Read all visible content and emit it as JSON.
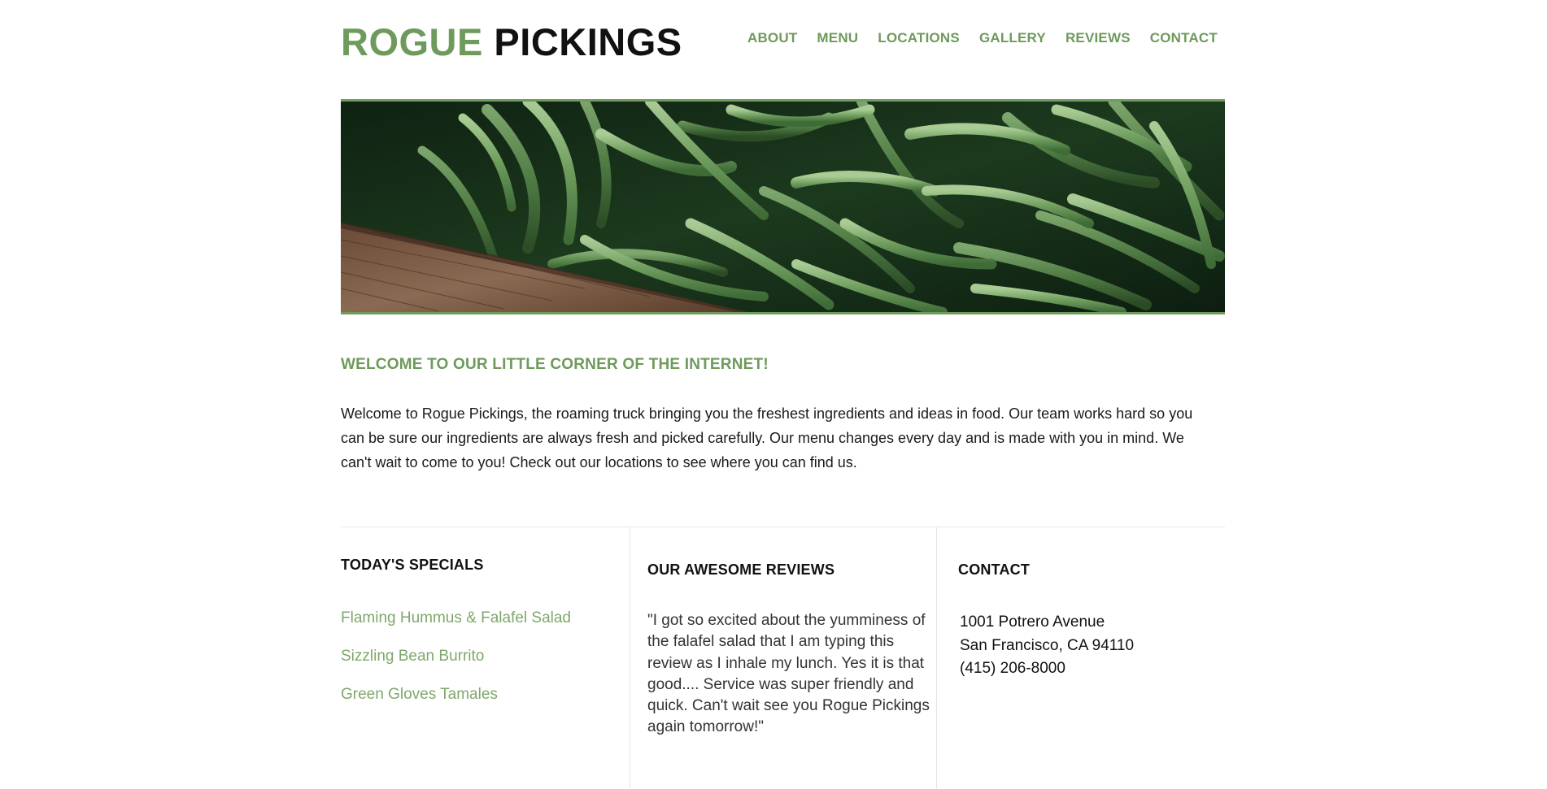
{
  "brand": {
    "name_accent": "ROGUE",
    "name_dark": "PICKINGS",
    "accent_color": "#6e9a5b"
  },
  "nav": {
    "items": [
      {
        "label": "ABOUT"
      },
      {
        "label": "MENU"
      },
      {
        "label": "LOCATIONS"
      },
      {
        "label": "GALLERY"
      },
      {
        "label": "REVIEWS"
      },
      {
        "label": "CONTACT"
      }
    ]
  },
  "hero": {
    "image_subject": "green-beans-photo"
  },
  "intro": {
    "heading": "WELCOME TO OUR LITTLE CORNER OF THE INTERNET!",
    "text": "Welcome to Rogue Pickings, the roaming truck bringing you the freshest ingredients and ideas in food. Our team works hard so you can be sure our ingredients are always fresh and picked carefully. Our menu changes every day and is made with you in mind. We can't wait to come to you! Check out our locations to see where you can find us."
  },
  "specials": {
    "heading": "TODAY'S SPECIALS",
    "items": [
      "Flaming Hummus & Falafel Salad",
      "Sizzling Bean Burrito",
      "Green Gloves Tamales"
    ]
  },
  "reviews": {
    "heading": "OUR AWESOME REVIEWS",
    "text": "\"I got so excited about the yumminess of the falafel salad that I am typing this review as I inhale my lunch. Yes it is that good.... Service was super friendly and quick. Can't wait see you Rogue Pickings again tomorrow!\""
  },
  "contact": {
    "heading": "CONTACT",
    "address_line1": "1001 Potrero Avenue",
    "address_line2": "San Francisco, CA 94110",
    "phone": "(415) 206-8000"
  }
}
